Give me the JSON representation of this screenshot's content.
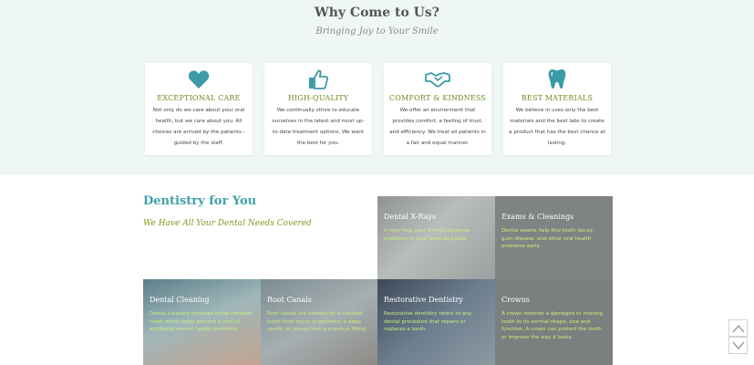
{
  "why": {
    "title": "Why Come to Us?",
    "subtitle": "Bringing Joy to Your Smile",
    "cards": [
      {
        "icon": "heart-icon",
        "title": "EXCEPTIONAL CARE",
        "text": "Not only do we care about your oral health, but we care about you. All choices are arrived by the patients - guided by the staff."
      },
      {
        "icon": "thumbs-up-icon",
        "title": "HIGH-QUALITY",
        "text": "We continually strive to educate ourselves in the latest and most up-to-date treatment options. We want the best for you."
      },
      {
        "icon": "handshake-icon",
        "title": "COMFORT & KINDNESS",
        "text": "We offer an environment that provides comfort, a feeling of trust, and efficiency. We treat all patients in a fair and equal manner."
      },
      {
        "icon": "tooth-icon",
        "title": "BEST MATERIALS",
        "text": "We believe in uses only the best materials and the best labs to create a product that has the best chance at lasting."
      }
    ]
  },
  "dentistry": {
    "title": "Dentistry for You",
    "subtitle": "We Have All Your Dental Needs Covered",
    "services": [
      {
        "name": "Dental X-Rays",
        "desc": "X-rays help your dentist diagnose problems in your teeth and jaws."
      },
      {
        "name": "Exams & Cleanings",
        "desc": "Dental exams help find tooth decay, gum disease, and other oral health problems early."
      },
      {
        "name": "Dental Cleaning",
        "desc": "Dental cleaning removes tartar between teeth which helps prevent a host of additional overall health problems."
      },
      {
        "name": "Root Canals",
        "desc": "Root canals are needed for a cracked tooth from injury or genetics, a deep cavity, or issues from a previous filling."
      },
      {
        "name": "Restorative Dentistry",
        "desc": "Restorative dentistry refers to any dental procedure that repairs or replaces a tooth."
      },
      {
        "name": "Crowns",
        "desc": "A crown restores a damaged or missing tooth to its normal shape, size and function. A crown can protect the tooth or improve the way it looks."
      }
    ]
  },
  "colors": {
    "section_bg": "#eef7f5",
    "icon_teal": "#3b9ba7",
    "card_title_green": "#6f8a1e",
    "heading_teal": "#3fa0aa",
    "tile_desc_green": "#c8f07a"
  },
  "scroll": {
    "up_icon": "chevron-up-icon",
    "down_icon": "chevron-down-icon"
  }
}
